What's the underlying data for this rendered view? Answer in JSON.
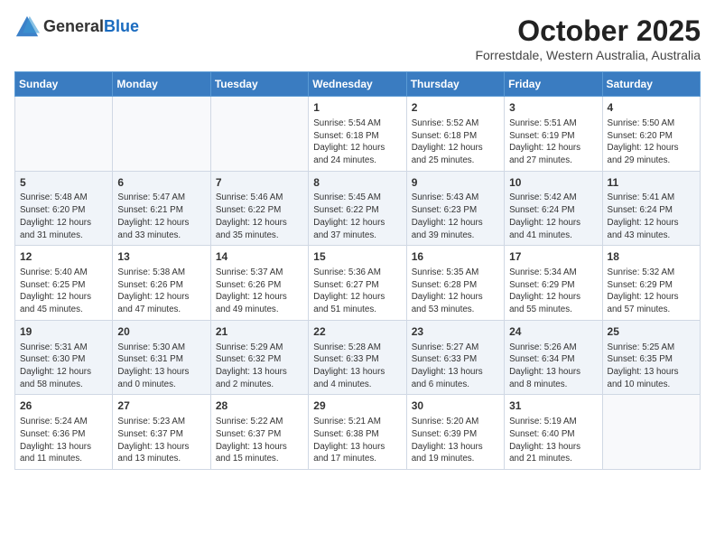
{
  "header": {
    "logo_general": "General",
    "logo_blue": "Blue",
    "title": "October 2025",
    "subtitle": "Forrestdale, Western Australia, Australia"
  },
  "days_of_week": [
    "Sunday",
    "Monday",
    "Tuesday",
    "Wednesday",
    "Thursday",
    "Friday",
    "Saturday"
  ],
  "weeks": [
    [
      {
        "day": "",
        "info": ""
      },
      {
        "day": "",
        "info": ""
      },
      {
        "day": "",
        "info": ""
      },
      {
        "day": "1",
        "info": "Sunrise: 5:54 AM\nSunset: 6:18 PM\nDaylight: 12 hours\nand 24 minutes."
      },
      {
        "day": "2",
        "info": "Sunrise: 5:52 AM\nSunset: 6:18 PM\nDaylight: 12 hours\nand 25 minutes."
      },
      {
        "day": "3",
        "info": "Sunrise: 5:51 AM\nSunset: 6:19 PM\nDaylight: 12 hours\nand 27 minutes."
      },
      {
        "day": "4",
        "info": "Sunrise: 5:50 AM\nSunset: 6:20 PM\nDaylight: 12 hours\nand 29 minutes."
      }
    ],
    [
      {
        "day": "5",
        "info": "Sunrise: 5:48 AM\nSunset: 6:20 PM\nDaylight: 12 hours\nand 31 minutes."
      },
      {
        "day": "6",
        "info": "Sunrise: 5:47 AM\nSunset: 6:21 PM\nDaylight: 12 hours\nand 33 minutes."
      },
      {
        "day": "7",
        "info": "Sunrise: 5:46 AM\nSunset: 6:22 PM\nDaylight: 12 hours\nand 35 minutes."
      },
      {
        "day": "8",
        "info": "Sunrise: 5:45 AM\nSunset: 6:22 PM\nDaylight: 12 hours\nand 37 minutes."
      },
      {
        "day": "9",
        "info": "Sunrise: 5:43 AM\nSunset: 6:23 PM\nDaylight: 12 hours\nand 39 minutes."
      },
      {
        "day": "10",
        "info": "Sunrise: 5:42 AM\nSunset: 6:24 PM\nDaylight: 12 hours\nand 41 minutes."
      },
      {
        "day": "11",
        "info": "Sunrise: 5:41 AM\nSunset: 6:24 PM\nDaylight: 12 hours\nand 43 minutes."
      }
    ],
    [
      {
        "day": "12",
        "info": "Sunrise: 5:40 AM\nSunset: 6:25 PM\nDaylight: 12 hours\nand 45 minutes."
      },
      {
        "day": "13",
        "info": "Sunrise: 5:38 AM\nSunset: 6:26 PM\nDaylight: 12 hours\nand 47 minutes."
      },
      {
        "day": "14",
        "info": "Sunrise: 5:37 AM\nSunset: 6:26 PM\nDaylight: 12 hours\nand 49 minutes."
      },
      {
        "day": "15",
        "info": "Sunrise: 5:36 AM\nSunset: 6:27 PM\nDaylight: 12 hours\nand 51 minutes."
      },
      {
        "day": "16",
        "info": "Sunrise: 5:35 AM\nSunset: 6:28 PM\nDaylight: 12 hours\nand 53 minutes."
      },
      {
        "day": "17",
        "info": "Sunrise: 5:34 AM\nSunset: 6:29 PM\nDaylight: 12 hours\nand 55 minutes."
      },
      {
        "day": "18",
        "info": "Sunrise: 5:32 AM\nSunset: 6:29 PM\nDaylight: 12 hours\nand 57 minutes."
      }
    ],
    [
      {
        "day": "19",
        "info": "Sunrise: 5:31 AM\nSunset: 6:30 PM\nDaylight: 12 hours\nand 58 minutes."
      },
      {
        "day": "20",
        "info": "Sunrise: 5:30 AM\nSunset: 6:31 PM\nDaylight: 13 hours\nand 0 minutes."
      },
      {
        "day": "21",
        "info": "Sunrise: 5:29 AM\nSunset: 6:32 PM\nDaylight: 13 hours\nand 2 minutes."
      },
      {
        "day": "22",
        "info": "Sunrise: 5:28 AM\nSunset: 6:33 PM\nDaylight: 13 hours\nand 4 minutes."
      },
      {
        "day": "23",
        "info": "Sunrise: 5:27 AM\nSunset: 6:33 PM\nDaylight: 13 hours\nand 6 minutes."
      },
      {
        "day": "24",
        "info": "Sunrise: 5:26 AM\nSunset: 6:34 PM\nDaylight: 13 hours\nand 8 minutes."
      },
      {
        "day": "25",
        "info": "Sunrise: 5:25 AM\nSunset: 6:35 PM\nDaylight: 13 hours\nand 10 minutes."
      }
    ],
    [
      {
        "day": "26",
        "info": "Sunrise: 5:24 AM\nSunset: 6:36 PM\nDaylight: 13 hours\nand 11 minutes."
      },
      {
        "day": "27",
        "info": "Sunrise: 5:23 AM\nSunset: 6:37 PM\nDaylight: 13 hours\nand 13 minutes."
      },
      {
        "day": "28",
        "info": "Sunrise: 5:22 AM\nSunset: 6:37 PM\nDaylight: 13 hours\nand 15 minutes."
      },
      {
        "day": "29",
        "info": "Sunrise: 5:21 AM\nSunset: 6:38 PM\nDaylight: 13 hours\nand 17 minutes."
      },
      {
        "day": "30",
        "info": "Sunrise: 5:20 AM\nSunset: 6:39 PM\nDaylight: 13 hours\nand 19 minutes."
      },
      {
        "day": "31",
        "info": "Sunrise: 5:19 AM\nSunset: 6:40 PM\nDaylight: 13 hours\nand 21 minutes."
      },
      {
        "day": "",
        "info": ""
      }
    ]
  ]
}
